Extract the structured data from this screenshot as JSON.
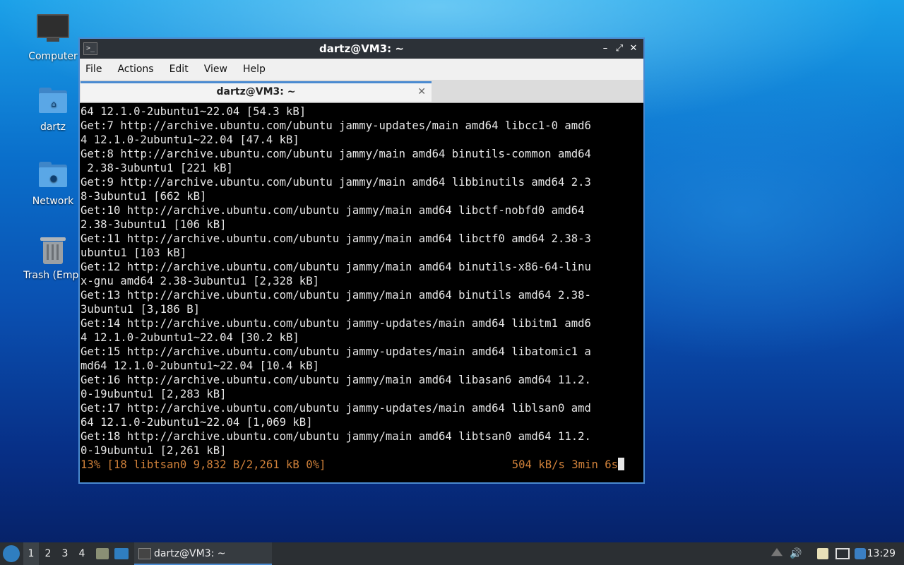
{
  "desktop": {
    "icons": [
      {
        "label": "Computer",
        "icon": "computer-icon"
      },
      {
        "label": "dartz",
        "icon": "home-folder-icon"
      },
      {
        "label": "Network",
        "icon": "network-folder-icon"
      },
      {
        "label": "Trash (Empt",
        "icon": "trash-icon"
      }
    ]
  },
  "window": {
    "title": "dartz@VM3: ~",
    "menu": [
      "File",
      "Actions",
      "Edit",
      "View",
      "Help"
    ],
    "tab_title": "dartz@VM3: ~",
    "terminal_lines": [
      "64 12.1.0-2ubuntu1~22.04 [54.3 kB]",
      "Get:7 http://archive.ubuntu.com/ubuntu jammy-updates/main amd64 libcc1-0 amd6",
      "4 12.1.0-2ubuntu1~22.04 [47.4 kB]",
      "Get:8 http://archive.ubuntu.com/ubuntu jammy/main amd64 binutils-common amd64",
      " 2.38-3ubuntu1 [221 kB]",
      "Get:9 http://archive.ubuntu.com/ubuntu jammy/main amd64 libbinutils amd64 2.3",
      "8-3ubuntu1 [662 kB]",
      "Get:10 http://archive.ubuntu.com/ubuntu jammy/main amd64 libctf-nobfd0 amd64",
      "2.38-3ubuntu1 [106 kB]",
      "Get:11 http://archive.ubuntu.com/ubuntu jammy/main amd64 libctf0 amd64 2.38-3",
      "ubuntu1 [103 kB]",
      "Get:12 http://archive.ubuntu.com/ubuntu jammy/main amd64 binutils-x86-64-linu",
      "x-gnu amd64 2.38-3ubuntu1 [2,328 kB]",
      "Get:13 http://archive.ubuntu.com/ubuntu jammy/main amd64 binutils amd64 2.38-",
      "3ubuntu1 [3,186 B]",
      "Get:14 http://archive.ubuntu.com/ubuntu jammy-updates/main amd64 libitm1 amd6",
      "4 12.1.0-2ubuntu1~22.04 [30.2 kB]",
      "Get:15 http://archive.ubuntu.com/ubuntu jammy-updates/main amd64 libatomic1 a",
      "md64 12.1.0-2ubuntu1~22.04 [10.4 kB]",
      "Get:16 http://archive.ubuntu.com/ubuntu jammy/main amd64 libasan6 amd64 11.2.",
      "0-19ubuntu1 [2,283 kB]",
      "Get:17 http://archive.ubuntu.com/ubuntu jammy-updates/main amd64 liblsan0 amd",
      "64 12.1.0-2ubuntu1~22.04 [1,069 kB]",
      "Get:18 http://archive.ubuntu.com/ubuntu jammy/main amd64 libtsan0 amd64 11.2.",
      "0-19ubuntu1 [2,261 kB]"
    ],
    "progress_left": "13% [18 libtsan0 9,832 B/2,261 kB 0%]",
    "progress_right": "504 kB/s 3min 6s"
  },
  "taskbar": {
    "workspaces": [
      "1",
      "2",
      "3",
      "4"
    ],
    "active_workspace": "1",
    "task_label": "dartz@VM3: ~",
    "clock": "13:29"
  },
  "colors": {
    "accent": "#4a8ad0",
    "progress_text": "#d0813a"
  }
}
